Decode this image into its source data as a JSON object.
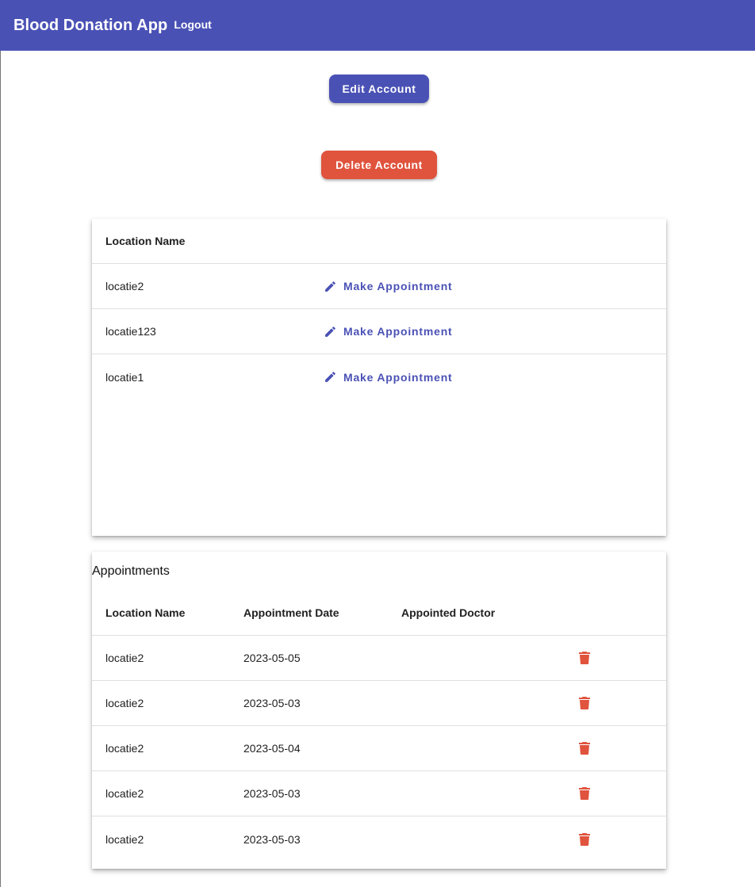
{
  "header": {
    "title": "Blood Donation App",
    "logout_label": "Logout",
    "color": "#4a51b5"
  },
  "buttons": {
    "edit_account": "Edit Account",
    "delete_account": "Delete Account",
    "delete_color": "#e0533d"
  },
  "locations": {
    "header": "Location Name",
    "action_label": "Make Appointment",
    "action_icon": "pencil-icon",
    "rows": [
      {
        "name": "locatie2"
      },
      {
        "name": "locatie123"
      },
      {
        "name": "locatie1"
      }
    ]
  },
  "appointments": {
    "title": "Appointments",
    "headers": {
      "location": "Location Name",
      "date": "Appointment Date",
      "doctor": "Appointed Doctor"
    },
    "delete_icon": "trash-icon",
    "rows": [
      {
        "location": "locatie2",
        "date": "2023-05-05",
        "doctor": ""
      },
      {
        "location": "locatie2",
        "date": "2023-05-03",
        "doctor": ""
      },
      {
        "location": "locatie2",
        "date": "2023-05-04",
        "doctor": ""
      },
      {
        "location": "locatie2",
        "date": "2023-05-03",
        "doctor": ""
      },
      {
        "location": "locatie2",
        "date": "2023-05-03",
        "doctor": ""
      }
    ]
  }
}
